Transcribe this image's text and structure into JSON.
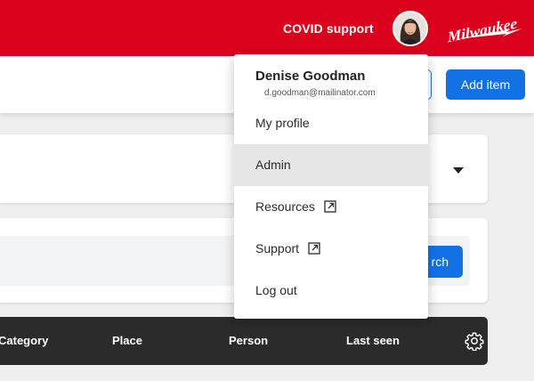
{
  "header": {
    "covid_link": "COVID support",
    "brand": "Milwaukee",
    "brand_color": "#db021d"
  },
  "toolbar": {
    "add_item_label": "Add item",
    "accent": "#1371e6"
  },
  "filters": {
    "search_button_label": "rch"
  },
  "table": {
    "columns": [
      "Category",
      "Place",
      "Person",
      "Last seen"
    ],
    "settings_icon": "gear-icon"
  },
  "user_menu": {
    "name": "Denise Goodman",
    "email": "d.goodman@mailinator.com",
    "items": [
      {
        "label": "My profile",
        "external": false
      },
      {
        "label": "Admin",
        "external": false,
        "active": true
      },
      {
        "label": "Resources",
        "external": true
      },
      {
        "label": "Support",
        "external": true
      },
      {
        "label": "Log out",
        "external": false
      }
    ]
  }
}
